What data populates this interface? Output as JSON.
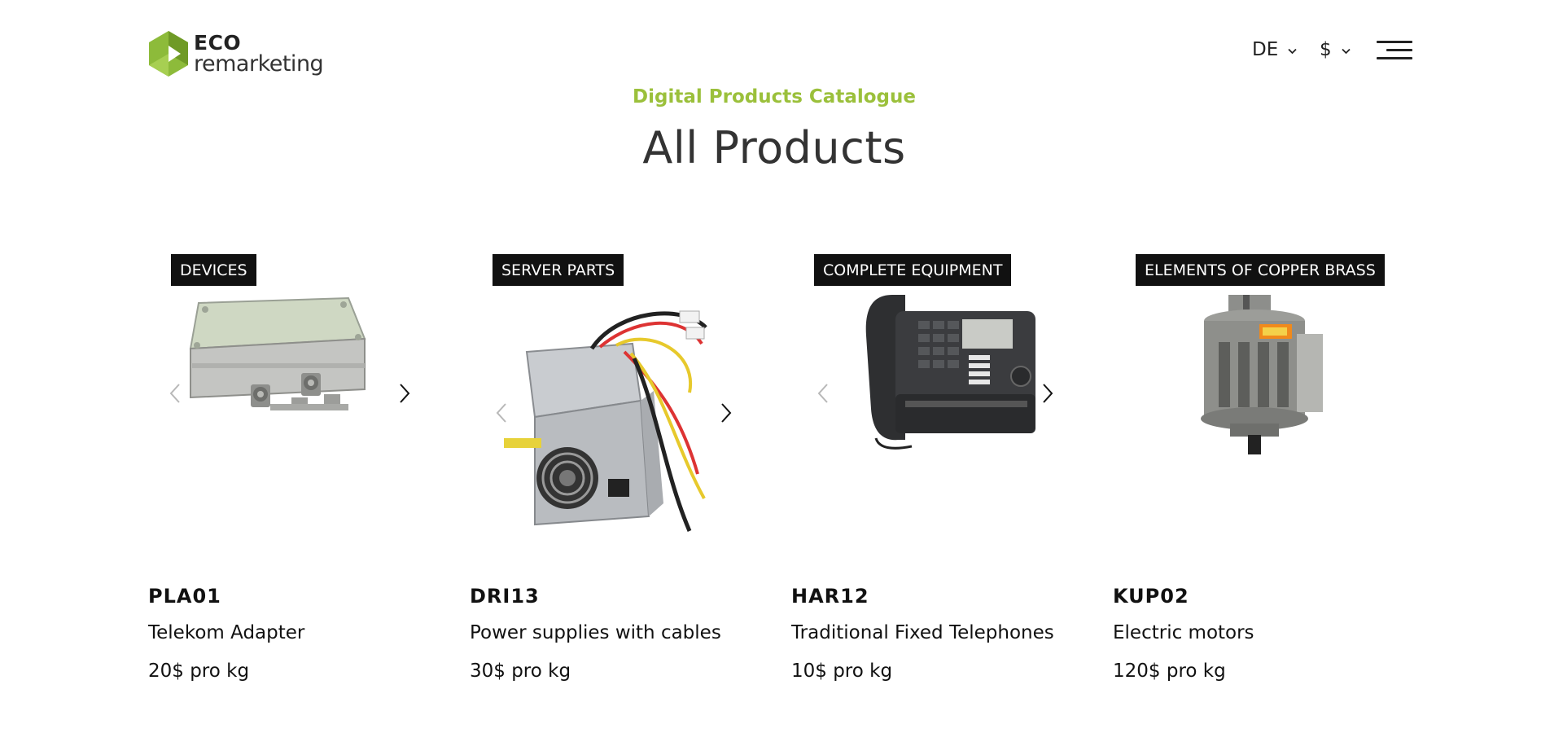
{
  "header": {
    "logo": {
      "word1": "ECO",
      "word2": "remarketing",
      "color": "#8dbb3a"
    },
    "language": {
      "selected": "DE"
    },
    "currency": {
      "selected": "$"
    }
  },
  "catalogue": {
    "subtitle": "Digital Products Catalogue",
    "title": "All Products"
  },
  "colors": {
    "accent": "#9bc03b",
    "badge_bg": "#111111"
  },
  "products": [
    {
      "category": "DEVICES",
      "code": "PLA01",
      "name": "Telekom Adapter",
      "price": "20$ pro kg"
    },
    {
      "category": "SERVER PARTS",
      "code": "DRI13",
      "name": "Power supplies with cables",
      "price": "30$ pro kg"
    },
    {
      "category": "COMPLETE EQUIPMENT",
      "code": "HAR12",
      "name": "Traditional Fixed Telephones",
      "price": "10$ pro kg"
    },
    {
      "category": "ELEMENTS OF COPPER BRASS",
      "code": "KUP02",
      "name": "Electric motors",
      "price": "120$ pro kg"
    }
  ]
}
